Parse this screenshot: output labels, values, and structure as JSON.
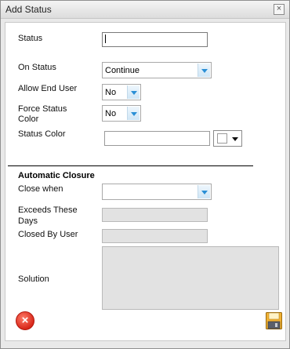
{
  "dialog": {
    "title": "Add Status",
    "close_glyph": "×"
  },
  "form": {
    "status_label": "Status",
    "status_value": "",
    "on_status_label": "On Status",
    "on_status_value": "Continue",
    "allow_end_user_label": "Allow End User",
    "allow_end_user_value": "No",
    "force_status_color_label_1": "Force Status",
    "force_status_color_label_2": "Color",
    "force_status_color_value": "No",
    "status_color_label": "Status Color",
    "status_color_value": ""
  },
  "closure": {
    "section_title": "Automatic Closure",
    "close_when_label": "Close when",
    "close_when_value": "",
    "exceeds_days_label_1": "Exceeds These",
    "exceeds_days_label_2": "Days",
    "closed_by_user_label": "Closed By User",
    "solution_label": "Solution"
  },
  "icons": {
    "cancel": "cancel-icon",
    "save": "save-icon",
    "dropdown": "chevron-down-icon"
  },
  "colors": {
    "accent_arrow": "#2a8fd6",
    "cancel_red": "#d8281a",
    "disabled_fill": "#e2e2e2"
  }
}
